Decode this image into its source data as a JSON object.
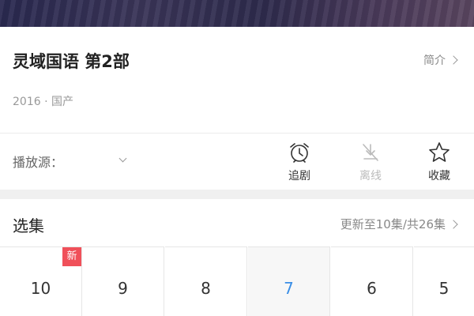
{
  "show": {
    "title": "灵域国语 第2部",
    "intro_label": "简介",
    "meta": "2016 · 国产"
  },
  "source": {
    "label": "播放源："
  },
  "actions": [
    {
      "label": "追剧",
      "icon": "alarm-clock-icon",
      "enabled": true
    },
    {
      "label": "离线",
      "icon": "offline-download-icon",
      "enabled": false
    },
    {
      "label": "收藏",
      "icon": "star-icon",
      "enabled": true
    }
  ],
  "episodes": {
    "title": "选集",
    "update_text": "更新至10集/共26集",
    "new_badge": "新",
    "items": [
      "10",
      "9",
      "8",
      "7",
      "6",
      "5"
    ],
    "selected": "7"
  },
  "colors": {
    "accent": "#3a8ee6",
    "badge": "#f0505a"
  }
}
